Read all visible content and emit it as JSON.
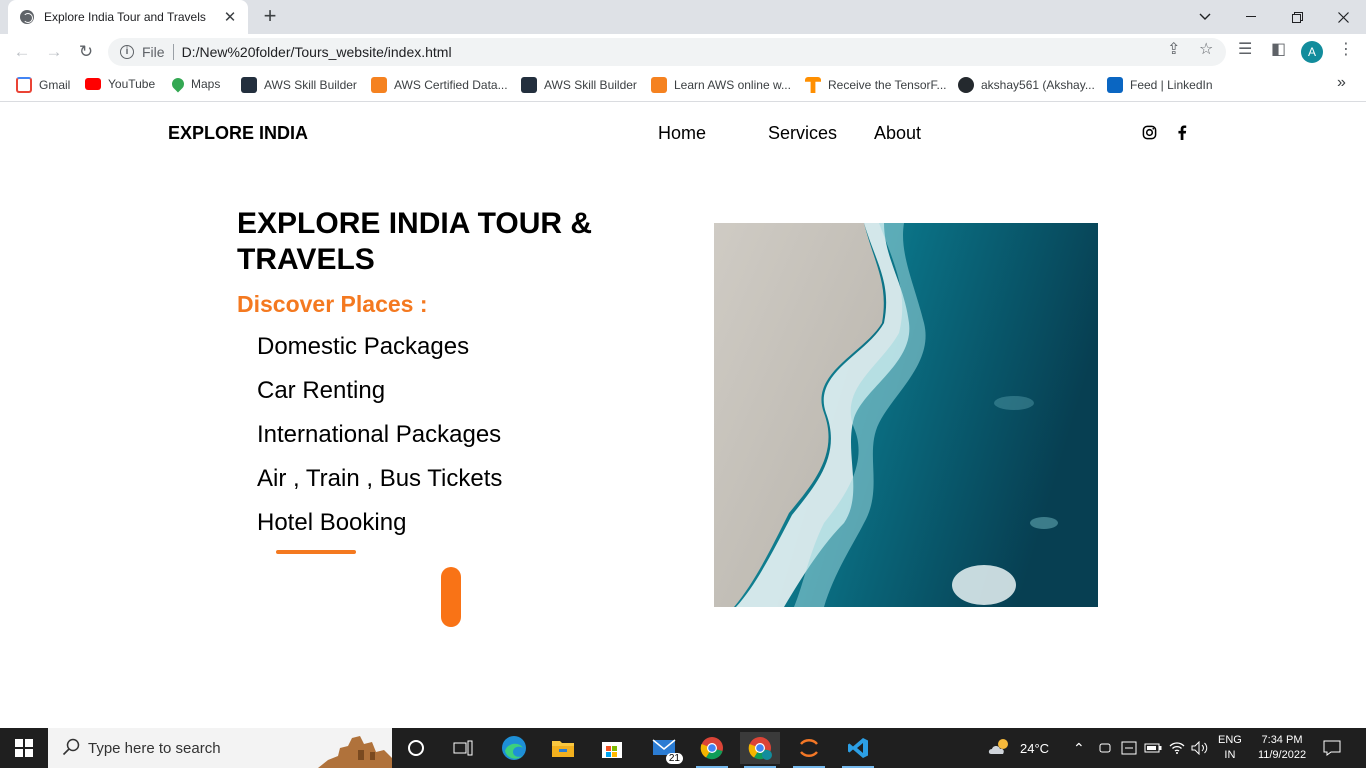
{
  "browser": {
    "tab_title": "Explore India Tour and Travels",
    "tab_close": "✕",
    "new_tab": "+",
    "url_scheme": "File",
    "url": "D:/New%20folder/Tours_website/index.html",
    "profile_initial": "A",
    "bookmarks": [
      {
        "label": "Gmail",
        "icon": "gmail-icon",
        "color": "#ea4335"
      },
      {
        "label": "YouTube",
        "icon": "youtube-icon",
        "color": "#ff0000"
      },
      {
        "label": "Maps",
        "icon": "maps-icon",
        "color": "#34a853"
      },
      {
        "label": "AWS Skill Builder",
        "icon": "aws-icon",
        "color": "#232f3e"
      },
      {
        "label": "AWS Certified Data...",
        "icon": "aws-cert-icon",
        "color": "#f58220"
      },
      {
        "label": "AWS Skill Builder",
        "icon": "aws-icon",
        "color": "#232f3e"
      },
      {
        "label": "Learn AWS online w...",
        "icon": "aws-learn-icon",
        "color": "#f58220"
      },
      {
        "label": "Receive the TensorF...",
        "icon": "tensorflow-icon",
        "color": "#ff8f00"
      },
      {
        "label": "akshay561 (Akshay...",
        "icon": "github-icon",
        "color": "#24292e"
      },
      {
        "label": "Feed | LinkedIn",
        "icon": "linkedin-icon",
        "color": "#0a66c2"
      }
    ],
    "more_bookmarks": "»"
  },
  "site": {
    "brand": "EXPLORE INDIA",
    "nav": [
      "Home",
      "Services",
      "About"
    ],
    "social": [
      "instagram-icon",
      "facebook-icon"
    ],
    "hero_title": "EXPLORE INDIA TOUR & TRAVELS",
    "discover": "Discover Places :",
    "services": [
      "Domestic Packages",
      "Car Renting",
      "International Packages",
      "Air , Train , Bus Tickets",
      "Hotel Booking"
    ],
    "accent": "#f47920"
  },
  "taskbar": {
    "search_placeholder": "Type here to search",
    "weather_temp": "24°C",
    "lang": "ENG",
    "region": "IN",
    "time": "7:34 PM",
    "date": "11/9/2022",
    "mail_badge": "21"
  }
}
